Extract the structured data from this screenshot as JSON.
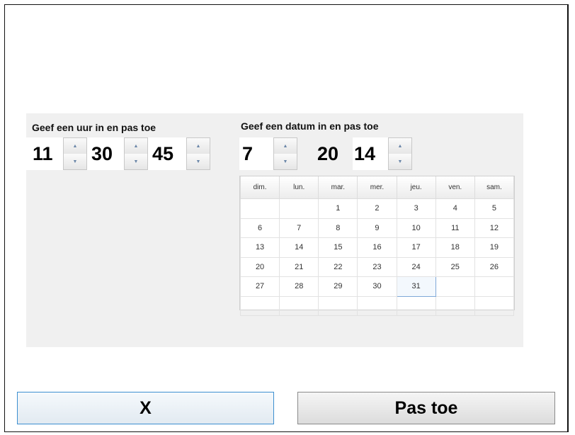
{
  "time": {
    "label": "Geef een uur in en pas toe",
    "hours": "11",
    "minutes": "30",
    "seconds": "45"
  },
  "date": {
    "label": "Geef een datum in en pas toe",
    "day": "7",
    "year_prefix": "20",
    "year_suffix": "14"
  },
  "spinner": {
    "up_icon": "▲",
    "down_icon": "▼"
  },
  "calendar": {
    "weekdays": [
      "dim.",
      "lun.",
      "mar.",
      "mer.",
      "jeu.",
      "ven.",
      "sam."
    ],
    "weeks": [
      [
        "",
        "",
        "1",
        "2",
        "3",
        "4",
        "5"
      ],
      [
        "6",
        "7",
        "8",
        "9",
        "10",
        "11",
        "12"
      ],
      [
        "13",
        "14",
        "15",
        "16",
        "17",
        "18",
        "19"
      ],
      [
        "20",
        "21",
        "22",
        "23",
        "24",
        "25",
        "26"
      ],
      [
        "27",
        "28",
        "29",
        "30",
        "31",
        "",
        ""
      ],
      [
        "",
        "",
        "",
        "",
        "",
        "",
        ""
      ]
    ],
    "selected": "31"
  },
  "buttons": {
    "cancel": "X",
    "apply": "Pas toe"
  }
}
